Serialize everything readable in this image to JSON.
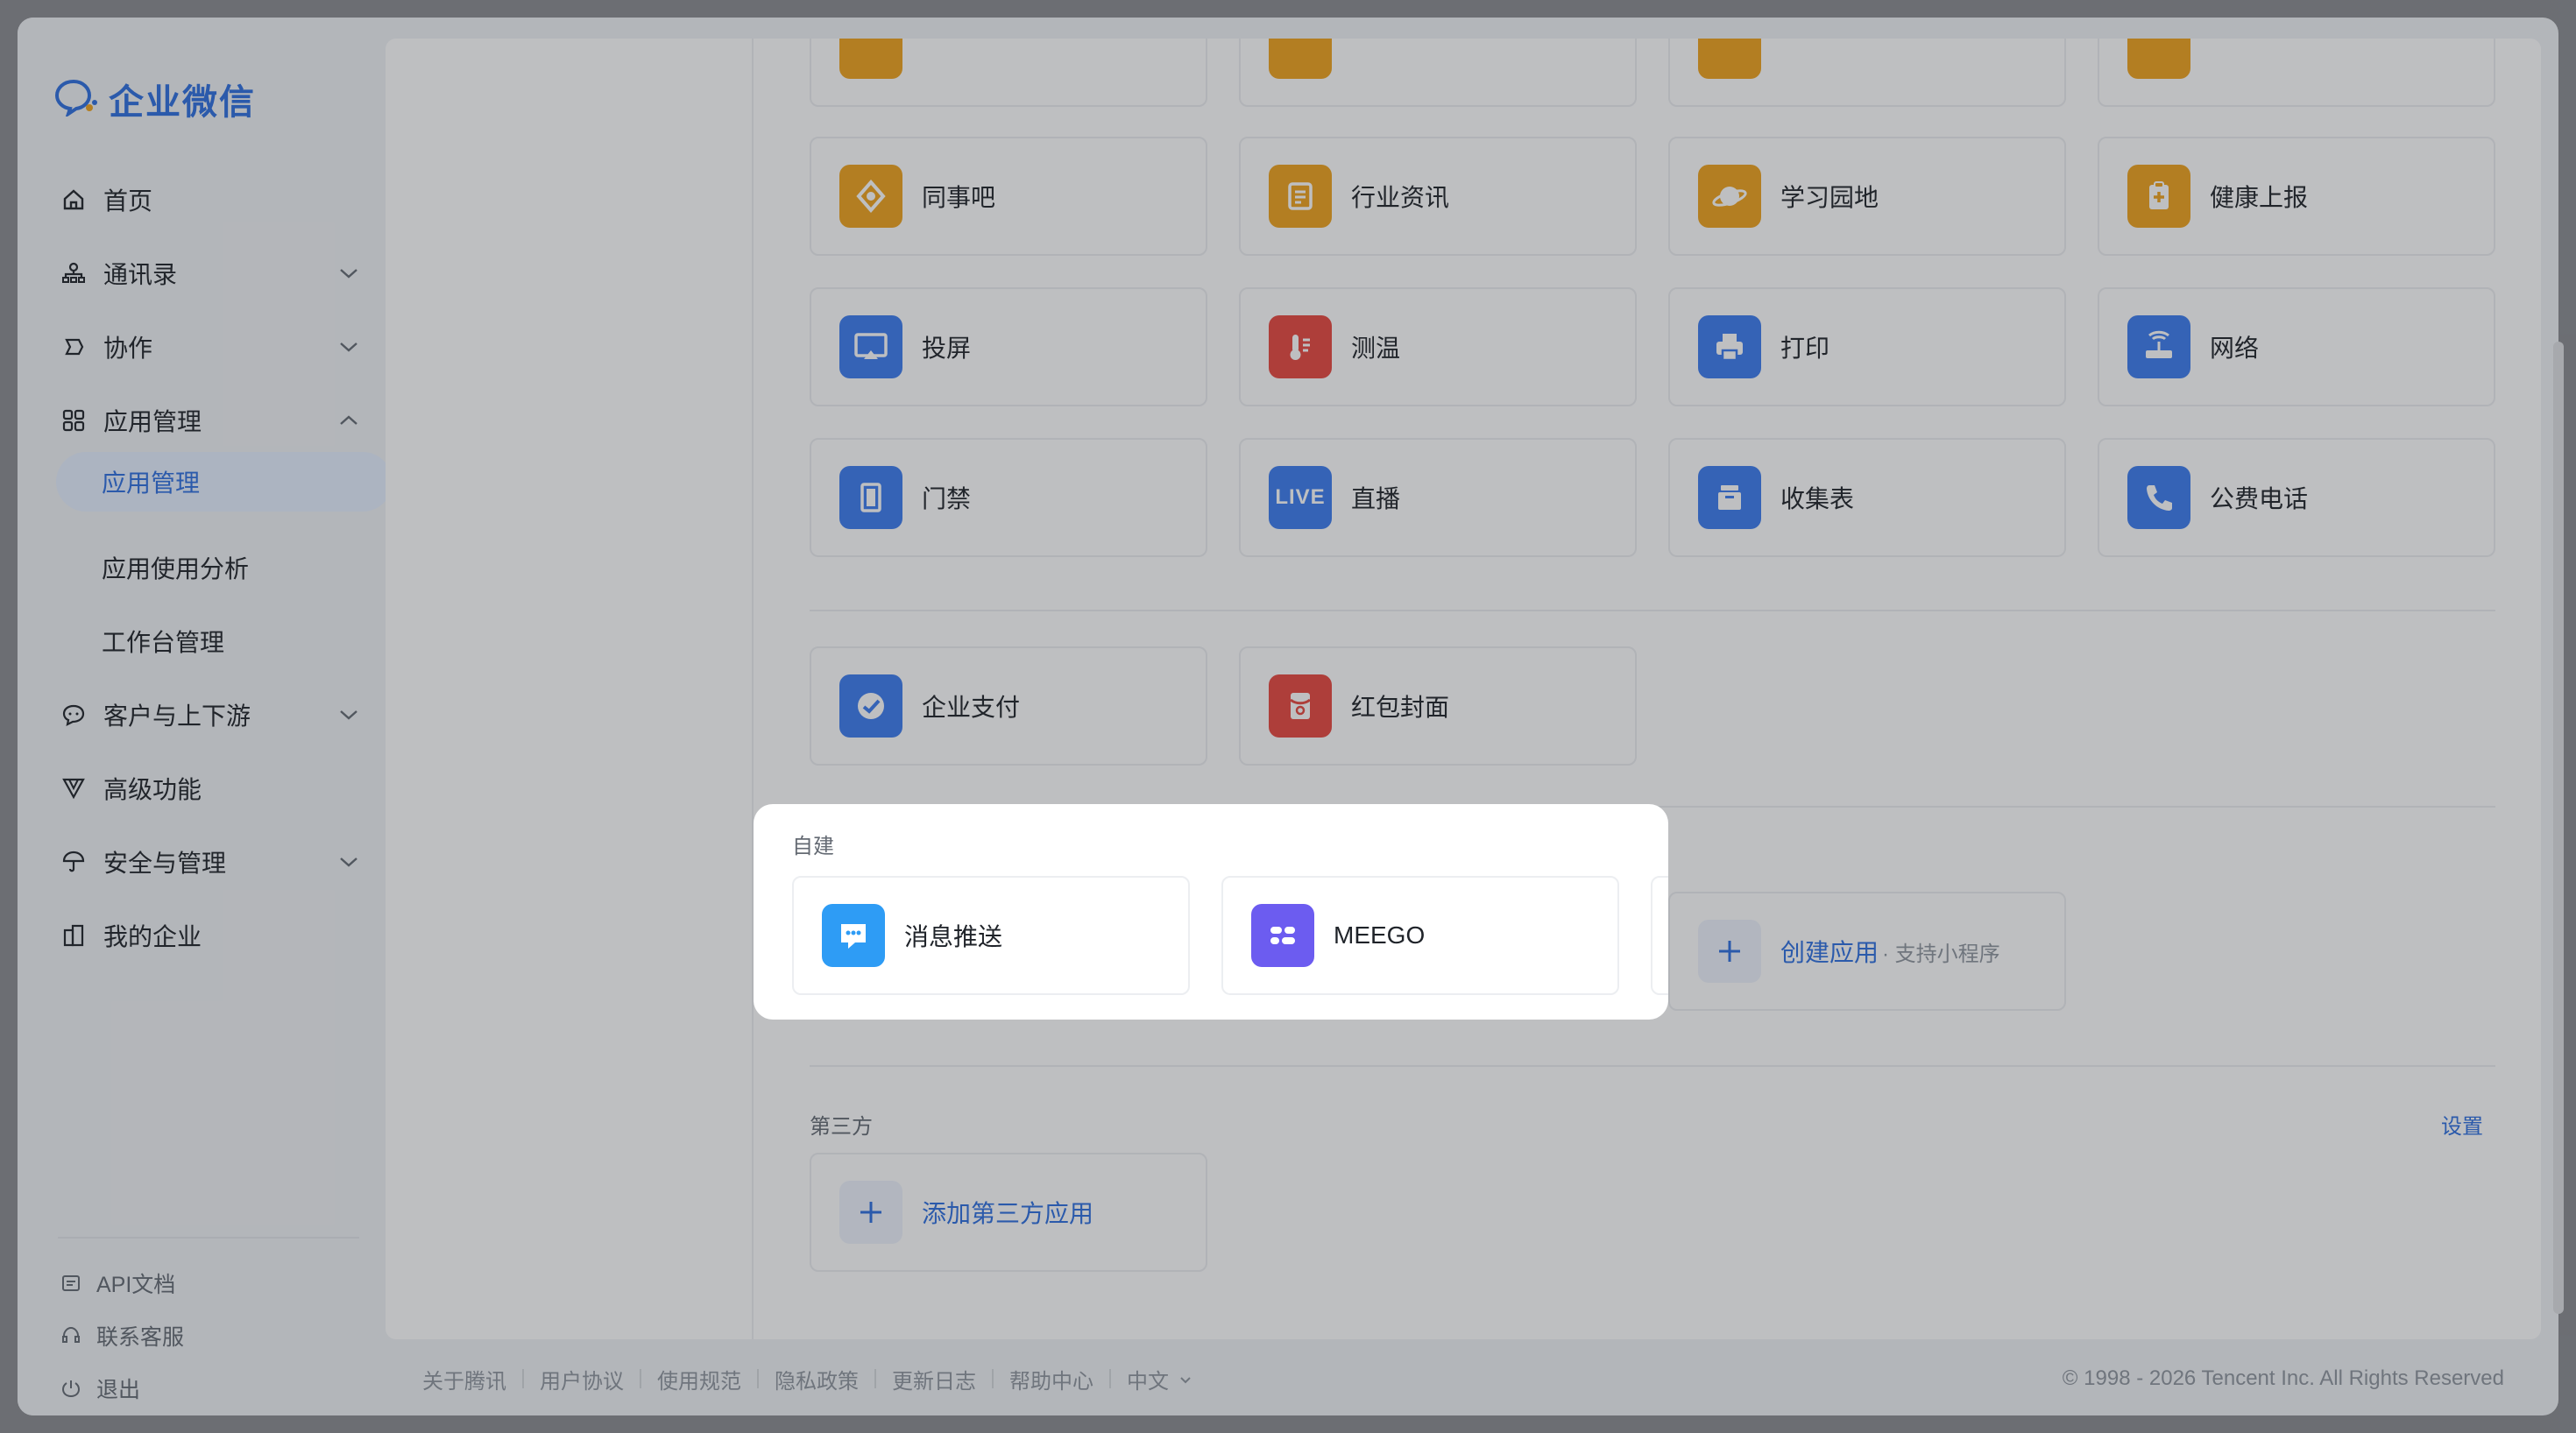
{
  "app": {
    "logo_text": "企业微信"
  },
  "sidebar": {
    "items": [
      {
        "label": "首页",
        "icon": "home-icon"
      },
      {
        "label": "通讯录",
        "icon": "org-icon"
      },
      {
        "label": "协作",
        "icon": "collab-icon"
      },
      {
        "label": "应用管理",
        "icon": "grid-icon"
      },
      {
        "label": "客户与上下游",
        "icon": "chat-icon"
      },
      {
        "label": "高级功能",
        "icon": "funnel-icon"
      },
      {
        "label": "安全与管理",
        "icon": "umbrella-icon"
      },
      {
        "label": "我的企业",
        "icon": "building-icon"
      }
    ],
    "sub_items": [
      "应用管理",
      "应用使用分析",
      "工作台管理"
    ],
    "footer": [
      {
        "label": "API文档",
        "icon": "doc-icon"
      },
      {
        "label": "联系客服",
        "icon": "headset-icon"
      },
      {
        "label": "退出",
        "icon": "power-icon"
      }
    ]
  },
  "apps": {
    "row1": [
      "同事吧",
      "行业资讯",
      "学习园地",
      "健康上报"
    ],
    "row2": [
      "投屏",
      "测温",
      "打印",
      "网络"
    ],
    "row3": [
      "门禁",
      "直播",
      "收集表",
      "公费电话"
    ],
    "row4": [
      "企业支付",
      "红包封面"
    ],
    "live_badge": "LIVE"
  },
  "self_built": {
    "title": "自建",
    "apps": [
      "消息推送",
      "MEEGO"
    ],
    "create_label": "创建应用",
    "create_hint": "· 支持小程序"
  },
  "third_party": {
    "title": "第三方",
    "settings": "设置",
    "add_label": "添加第三方应用"
  },
  "footer": {
    "links": [
      "关于腾讯",
      "用户协议",
      "使用规范",
      "隐私政策",
      "更新日志",
      "帮助中心",
      "中文"
    ],
    "copyright": "© 1998 - 2026 Tencent Inc. All Rights Reserved"
  },
  "colors": {
    "accent": "#2d6fe0",
    "orange": "#f0a31c",
    "blue": "#3c7cf0",
    "red": "#e8473e",
    "purple": "#6c5cf0"
  }
}
